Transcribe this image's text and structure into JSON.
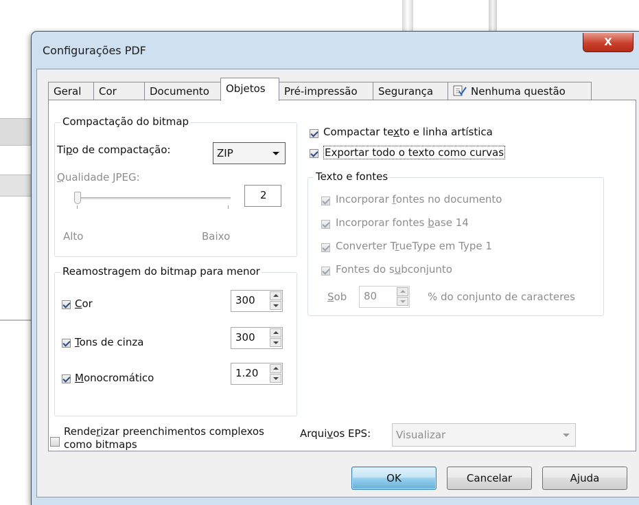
{
  "colors": {
    "frame": "#cfe0f1",
    "close": "#c9412d",
    "panel": "#ffffff",
    "client": "#f0f0f0"
  },
  "dialog": {
    "title": "Configurações PDF",
    "close_glyph": "X"
  },
  "tabs": [
    {
      "label": "Geral"
    },
    {
      "label": "Cor"
    },
    {
      "label": "Documento"
    },
    {
      "label": "Objetos"
    },
    {
      "label": "Pré-impressão"
    },
    {
      "label": "Segurança"
    },
    {
      "label": "Nenhuma questão",
      "icon": "checklist-icon"
    }
  ],
  "bitmap_compression": {
    "legend": "Compactação do bitmap",
    "type_label_a": "Ti",
    "type_label_u": "p",
    "type_label_b": "o de compactação:",
    "type_value": "ZIP",
    "jpeg_label_a": "Q",
    "jpeg_label_b": "ualidade JPEG:",
    "jpeg_quality": "2",
    "slider_min_label": "Alto",
    "slider_max_label": "Baixo"
  },
  "downsampling": {
    "legend": "Reamostragem do bitmap para menor",
    "items": [
      {
        "u": "C",
        "rest": "or",
        "checked": true,
        "value": "300"
      },
      {
        "u": "T",
        "rest": "ons de cinza",
        "checked": true,
        "value": "300"
      },
      {
        "u": "M",
        "rest": "onocromático",
        "checked": true,
        "value": "1.20"
      }
    ]
  },
  "compress_text": {
    "a": "Compactar te",
    "u": "x",
    "b": "to e linha artística",
    "checked": true
  },
  "export_curves": {
    "label": "Exportar todo o texto como curvas",
    "checked": true
  },
  "text_fonts": {
    "legend": "Texto e fontes",
    "items": [
      {
        "a": "Incorporar ",
        "u": "f",
        "b": "ontes no documento",
        "checked": true
      },
      {
        "a": "Incorporar fontes ",
        "u": "b",
        "b": "ase 14",
        "checked": true
      },
      {
        "a": "Converter T",
        "u": "r",
        "b": "ueType em Type 1",
        "checked": true
      },
      {
        "a": "Fontes do s",
        "u": "u",
        "b": "bconjunto",
        "checked": true
      }
    ],
    "under_label_u": "S",
    "under_label_b": "ob",
    "under_value": "80",
    "charset_label": "% do conjunto de caracteres"
  },
  "render_complex": {
    "a": "Rende",
    "u": "r",
    "b": "izar preenchimentos complexos",
    "line2": "como bitmaps",
    "checked": false
  },
  "eps": {
    "label_a": "Arqui",
    "label_u": "v",
    "label_b": "os EPS:",
    "value": "Visualizar"
  },
  "buttons": {
    "ok": "OK",
    "cancel": "Cancelar",
    "help": "Ajuda"
  }
}
